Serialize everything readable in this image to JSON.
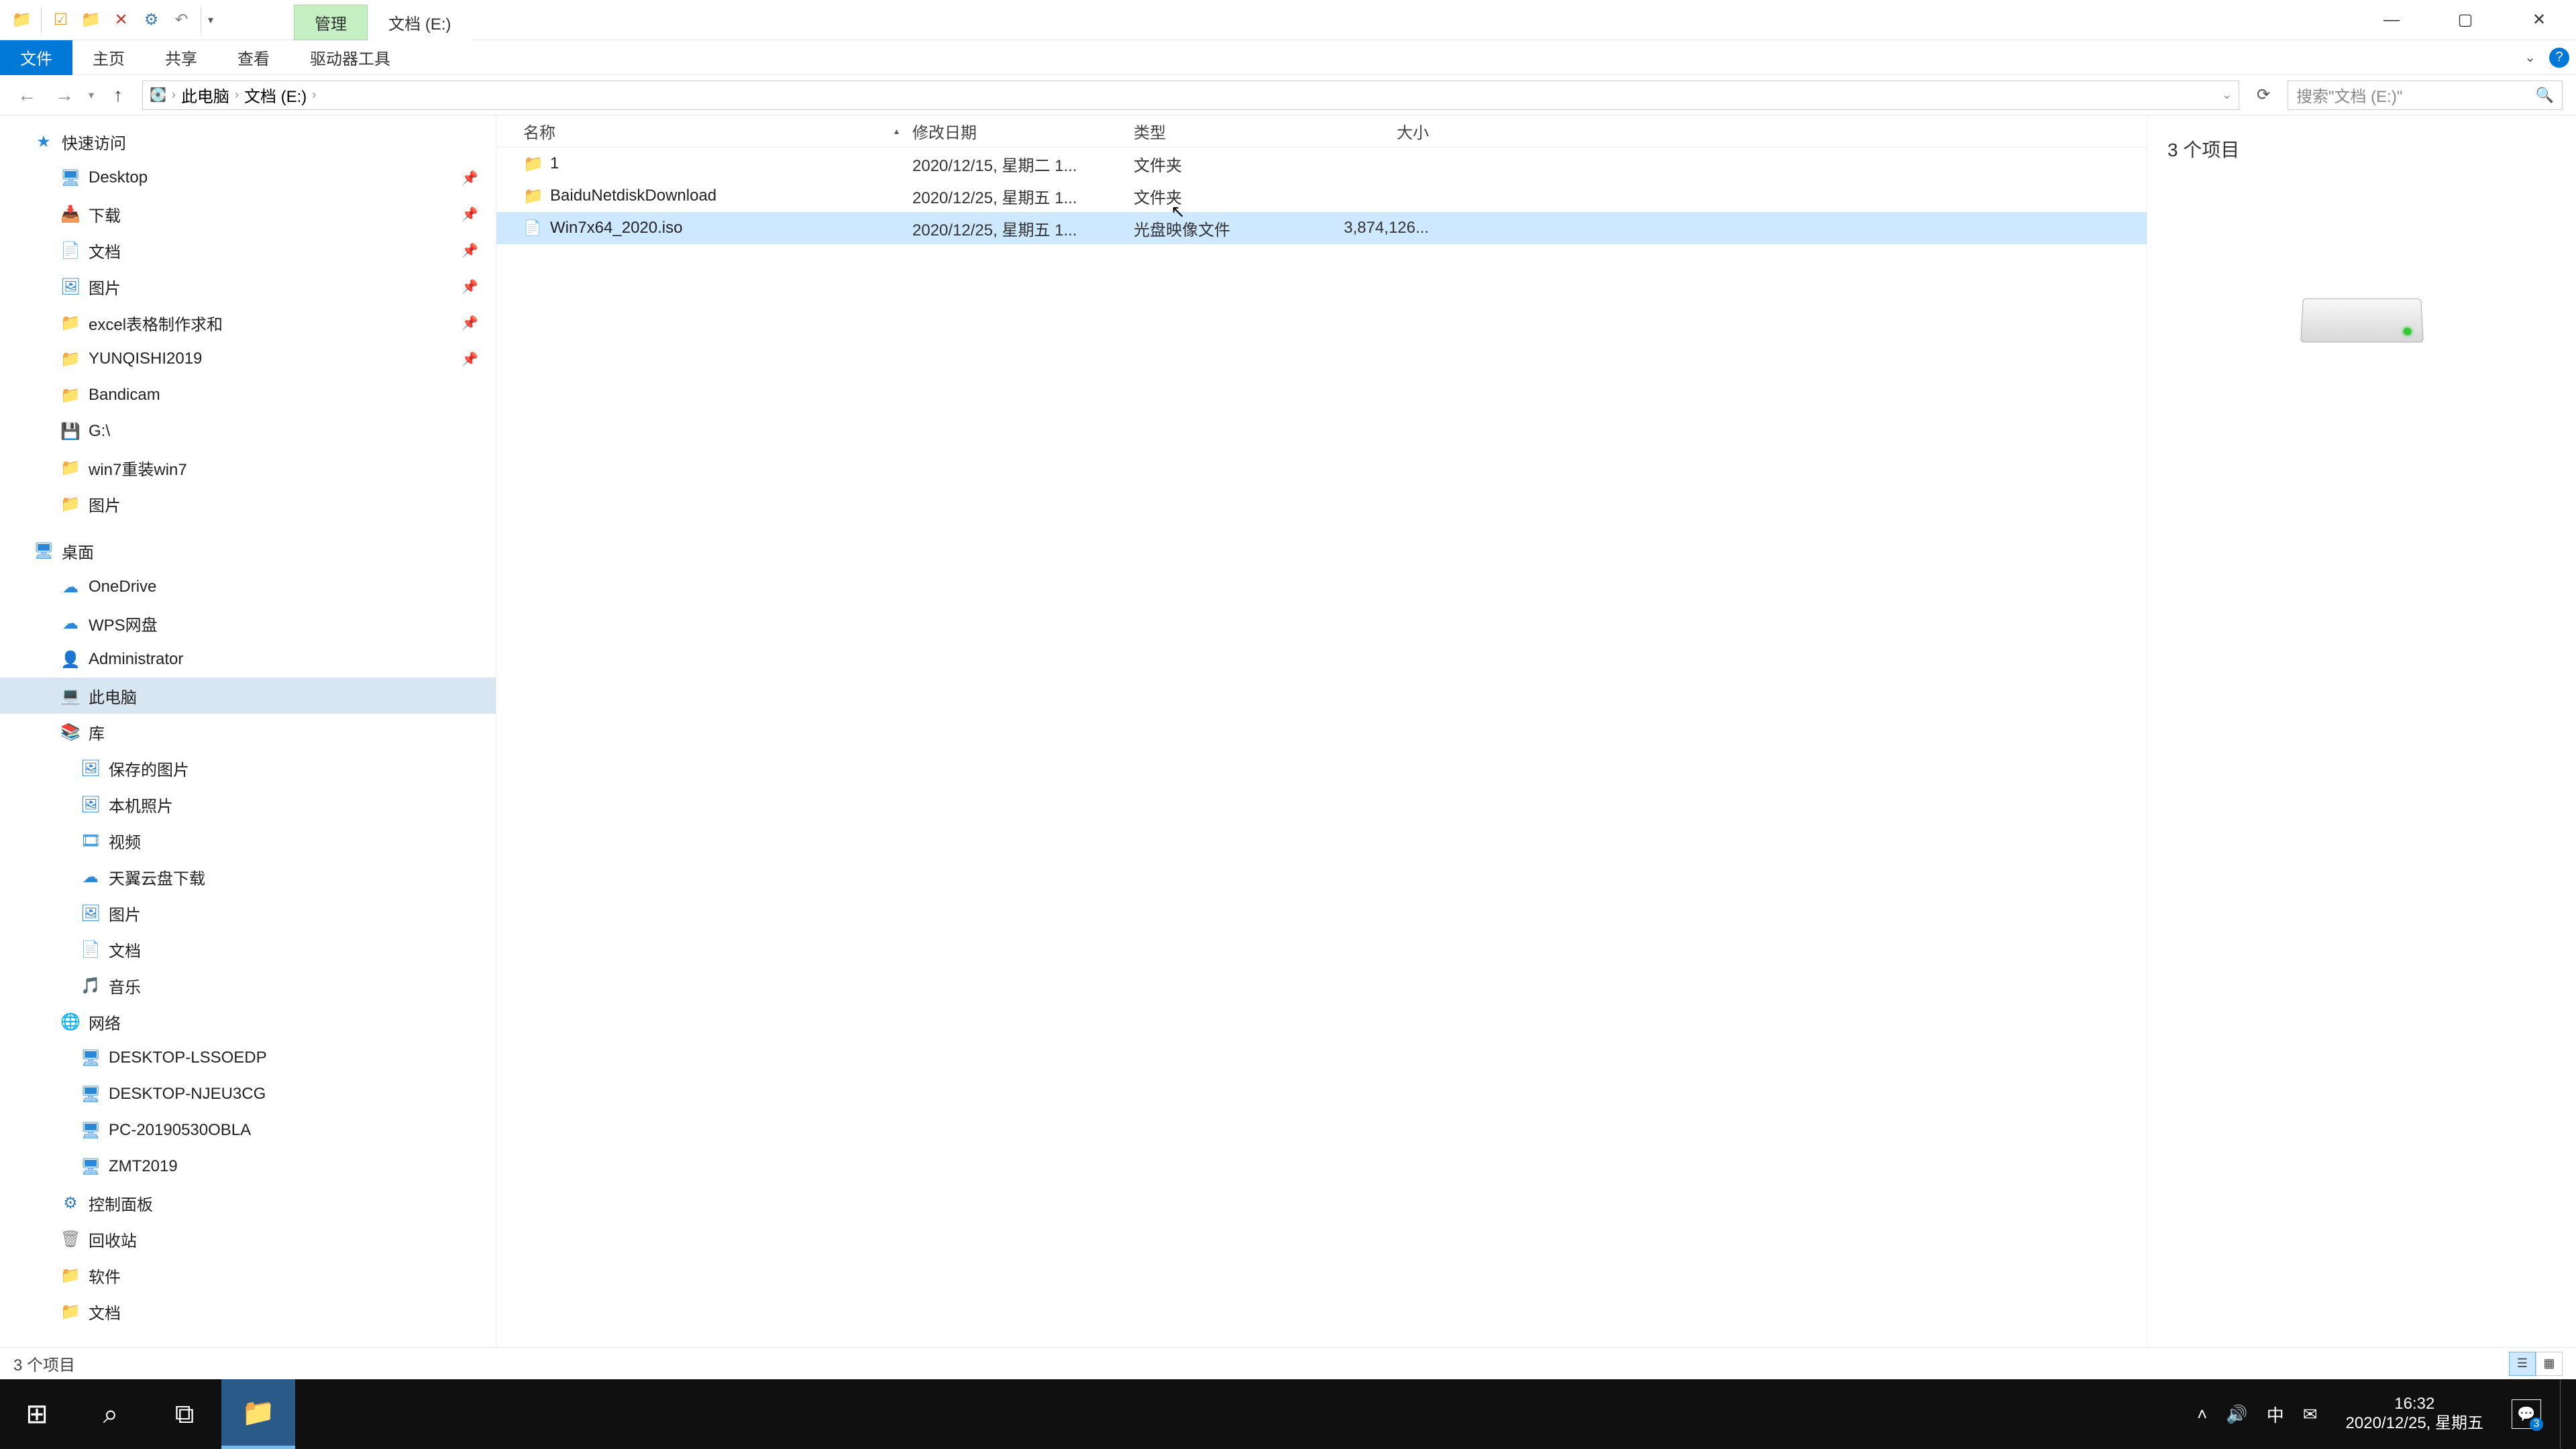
{
  "titlebar": {
    "context_tab": "管理",
    "location_tab": "文档 (E:)"
  },
  "ribbon": {
    "file": "文件",
    "home": "主页",
    "share": "共享",
    "view": "查看",
    "drive_tools": "驱动器工具"
  },
  "address": {
    "crumbs": [
      "此电脑",
      "文档 (E:)"
    ],
    "search_placeholder": "搜索\"文档 (E:)\""
  },
  "navpane": {
    "quick_access": "快速访问",
    "qa_items": [
      {
        "label": "Desktop",
        "icon": "🖥",
        "cls": "tree-icon-blue"
      },
      {
        "label": "下载",
        "icon": "📥",
        "cls": "tree-icon-blue"
      },
      {
        "label": "文档",
        "icon": "📄",
        "cls": "tree-icon-blue"
      },
      {
        "label": "图片",
        "icon": "🖼",
        "cls": "tree-icon-blue"
      },
      {
        "label": "excel表格制作求和",
        "icon": "📁",
        "cls": "tree-icon-folder"
      },
      {
        "label": "YUNQISHI2019",
        "icon": "📁",
        "cls": "tree-icon-folder"
      },
      {
        "label": "Bandicam",
        "icon": "📁",
        "cls": "tree-icon-folder"
      },
      {
        "label": "G:\\",
        "icon": "💾",
        "cls": "tree-icon-blue"
      },
      {
        "label": "win7重装win7",
        "icon": "📁",
        "cls": "tree-icon-folder"
      },
      {
        "label": "图片",
        "icon": "📁",
        "cls": "tree-icon-folder"
      }
    ],
    "desktop": "桌面",
    "desktop_items": [
      {
        "label": "OneDrive",
        "icon": "☁",
        "cls": "tree-icon-blue"
      },
      {
        "label": "WPS网盘",
        "icon": "☁",
        "cls": "tree-icon-blue"
      },
      {
        "label": "Administrator",
        "icon": "👤",
        "cls": "tree-icon-green"
      },
      {
        "label": "此电脑",
        "icon": "💻",
        "cls": "tree-icon-pc",
        "selected": true
      },
      {
        "label": "库",
        "icon": "📚",
        "cls": "tree-icon-folder"
      }
    ],
    "library_items": [
      {
        "label": "保存的图片",
        "icon": "🖼"
      },
      {
        "label": "本机照片",
        "icon": "🖼"
      },
      {
        "label": "视频",
        "icon": "🎞"
      },
      {
        "label": "天翼云盘下载",
        "icon": "☁"
      },
      {
        "label": "图片",
        "icon": "🖼"
      },
      {
        "label": "文档",
        "icon": "📄"
      },
      {
        "label": "音乐",
        "icon": "🎵"
      }
    ],
    "network": "网络",
    "network_items": [
      {
        "label": "DESKTOP-LSSOEDP"
      },
      {
        "label": "DESKTOP-NJEU3CG"
      },
      {
        "label": "PC-20190530OBLA"
      },
      {
        "label": "ZMT2019"
      }
    ],
    "ctrl_panel": "控制面板",
    "recycle": "回收站",
    "software": "软件",
    "docs": "文档"
  },
  "columns": {
    "name": "名称",
    "date": "修改日期",
    "type": "类型",
    "size": "大小"
  },
  "files": [
    {
      "name": "1",
      "date": "2020/12/15, 星期二 1...",
      "type": "文件夹",
      "size": "",
      "icon": "folder"
    },
    {
      "name": "BaiduNetdiskDownload",
      "date": "2020/12/25, 星期五 1...",
      "type": "文件夹",
      "size": "",
      "icon": "folder"
    },
    {
      "name": "Win7x64_2020.iso",
      "date": "2020/12/25, 星期五 1...",
      "type": "光盘映像文件",
      "size": "3,874,126...",
      "icon": "file",
      "selected": true
    }
  ],
  "preview": {
    "item_count": "3 个项目"
  },
  "statusbar": {
    "text": "3 个项目"
  },
  "tray": {
    "time": "16:32",
    "date": "2020/12/25, 星期五",
    "ime": "中",
    "action_badge": "3"
  }
}
